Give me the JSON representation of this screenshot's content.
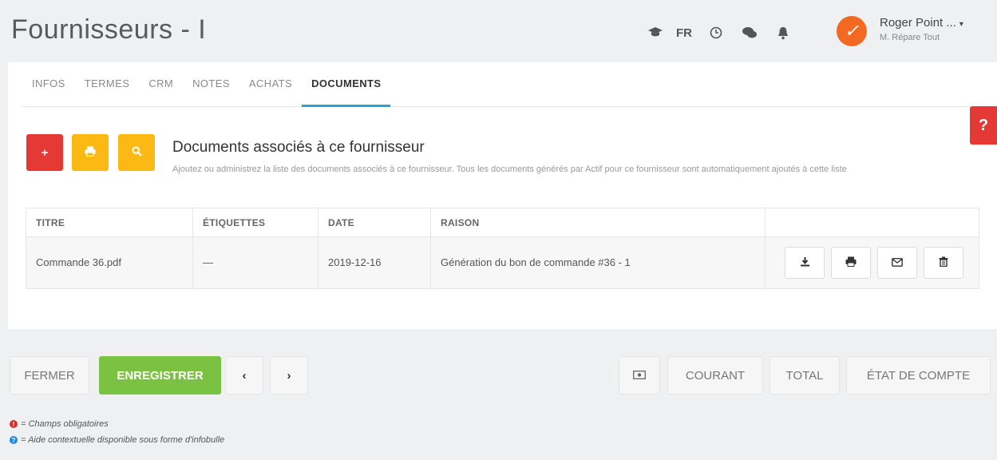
{
  "header": {
    "title": "Fournisseurs - I",
    "language": "FR",
    "icons": [
      "graduation-cap-icon",
      "clock-icon",
      "chat-icon",
      "bell-icon"
    ],
    "user_name": "Roger Point ...",
    "user_company": "M. Répare Tout"
  },
  "tabs": [
    {
      "label": "INFOS",
      "active": false
    },
    {
      "label": "TERMES",
      "active": false
    },
    {
      "label": "CRM",
      "active": false
    },
    {
      "label": "NOTES",
      "active": false
    },
    {
      "label": "ACHATS",
      "active": false
    },
    {
      "label": "DOCUMENTS",
      "active": true
    }
  ],
  "documents": {
    "title": "Documents associés à ce fournisseur",
    "description": "Ajoutez ou administrez la liste des documents associés à ce fournisseur. Tous les documents générés par Actif pour ce fournisseur sont automatiquement ajoutés à cette liste",
    "add_label": "+",
    "columns": [
      "TITRE",
      "ÉTIQUETTES",
      "DATE",
      "RAISON",
      ""
    ],
    "rows": [
      {
        "titre": "Commande 36.pdf",
        "etiquettes": "—",
        "date": "2019-12-16",
        "raison": "Génération du bon de commande #36 - 1"
      }
    ]
  },
  "help_label": "?",
  "footer": {
    "close_label": "FERMER",
    "save_label": "ENREGISTRER",
    "prev_label": "‹",
    "next_label": "›",
    "courant_label": "COURANT",
    "total_label": "TOTAL",
    "etat_label": "ÉTAT DE COMPTE"
  },
  "legend": {
    "required": "= Champs obligatoires",
    "tooltip": "= Aide contextuelle disponible sous forme d'infobulle"
  },
  "colors": {
    "accent_blue": "#2a9fd8",
    "danger_red": "#e53935",
    "warning_yellow": "#fdb913",
    "success_green": "#7cc242",
    "avatar_orange": "#f26a21"
  }
}
